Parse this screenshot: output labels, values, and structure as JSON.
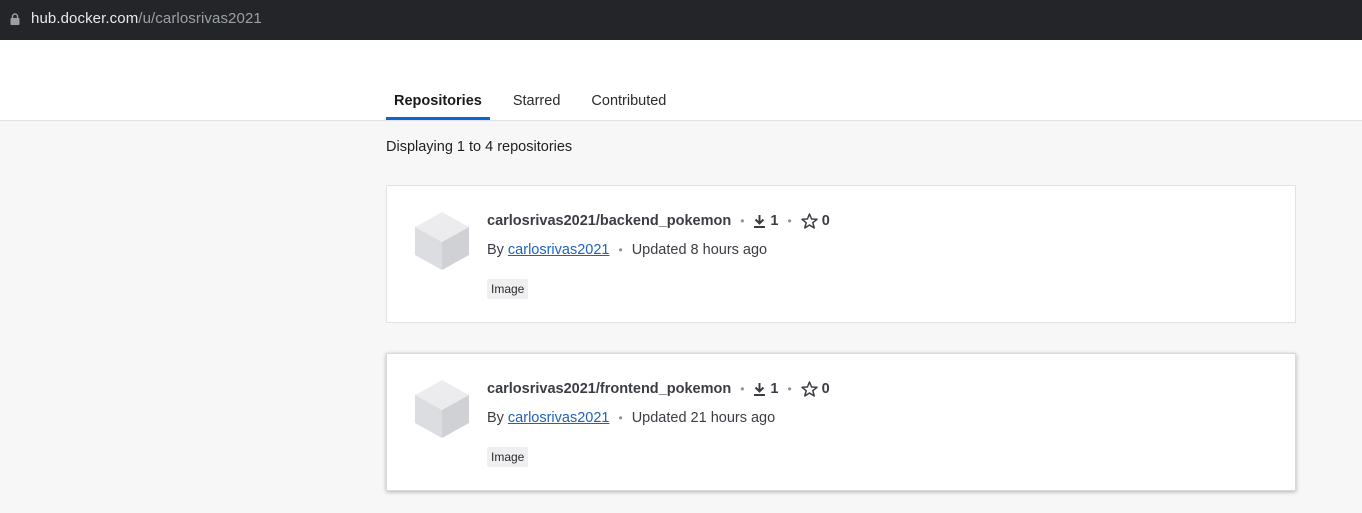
{
  "browser": {
    "url_host": "hub.docker.com",
    "url_path": "/u/carlosrivas2021"
  },
  "tabs": [
    {
      "label": "Repositories",
      "active": true
    },
    {
      "label": "Starred",
      "active": false
    },
    {
      "label": "Contributed",
      "active": false
    }
  ],
  "summary": "Displaying 1 to 4 repositories",
  "repositories": [
    {
      "name": "carlosrivas2021/backend_pokemon",
      "downloads": "1",
      "stars": "0",
      "by_prefix": "By",
      "owner": "carlosrivas2021",
      "updated": "Updated 8 hours ago",
      "badge": "Image"
    },
    {
      "name": "carlosrivas2021/frontend_pokemon",
      "downloads": "1",
      "stars": "0",
      "by_prefix": "By",
      "owner": "carlosrivas2021",
      "updated": "Updated 21 hours ago",
      "badge": "Image"
    }
  ],
  "colors": {
    "accent": "#0b66d0",
    "link": "#1d63b8",
    "urlbar_bg": "#232529"
  },
  "icons": [
    "lock-icon",
    "cube-icon",
    "download-icon",
    "star-icon"
  ]
}
